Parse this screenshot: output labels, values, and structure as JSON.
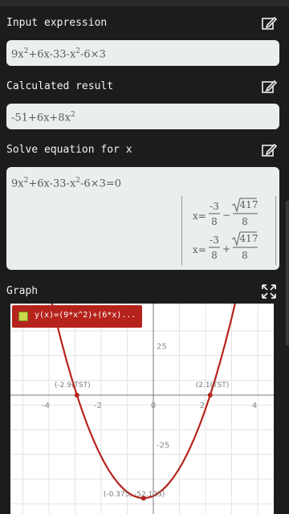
{
  "input": {
    "title": "Input expression",
    "expr_a": "9x",
    "expr_b": "+6x-33-x",
    "expr_c": "-6×3",
    "exp": "2"
  },
  "result": {
    "title": "Calculated result",
    "expr_a": "-51+6x+8x",
    "exp": "2"
  },
  "solve": {
    "title": "Solve equation for x",
    "eq_a": "9x",
    "eq_b": "+6x-33-x",
    "eq_c": "-6×3=0",
    "exp": "2",
    "sol1_lhs": "x=",
    "sol1_num": "-3",
    "sol1_den": "8",
    "sol1_op": "−",
    "sol1_root": "417",
    "sol1_rden": "8",
    "sol2_lhs": "x=",
    "sol2_num": "-3",
    "sol2_den": "8",
    "sol2_op": "+",
    "sol2_root": "417",
    "sol2_rden": "8"
  },
  "graph": {
    "title": "Graph",
    "legend": "y(x)=(9*x^2)+(6*x)..."
  },
  "chart_data": {
    "type": "line",
    "function": "y = 8x^2 + 6x - 51",
    "xlim": [
      -5,
      5
    ],
    "ylim": [
      -55,
      40
    ],
    "x_ticks": [
      "-4",
      "-2",
      "0",
      "2",
      "4"
    ],
    "y_ticks": [
      "25",
      "-25"
    ],
    "annotations": [
      "(-2.9(TST)",
      "(2.1(TST)",
      "(-0.375, -52.125)"
    ],
    "color": "#b5231c"
  }
}
